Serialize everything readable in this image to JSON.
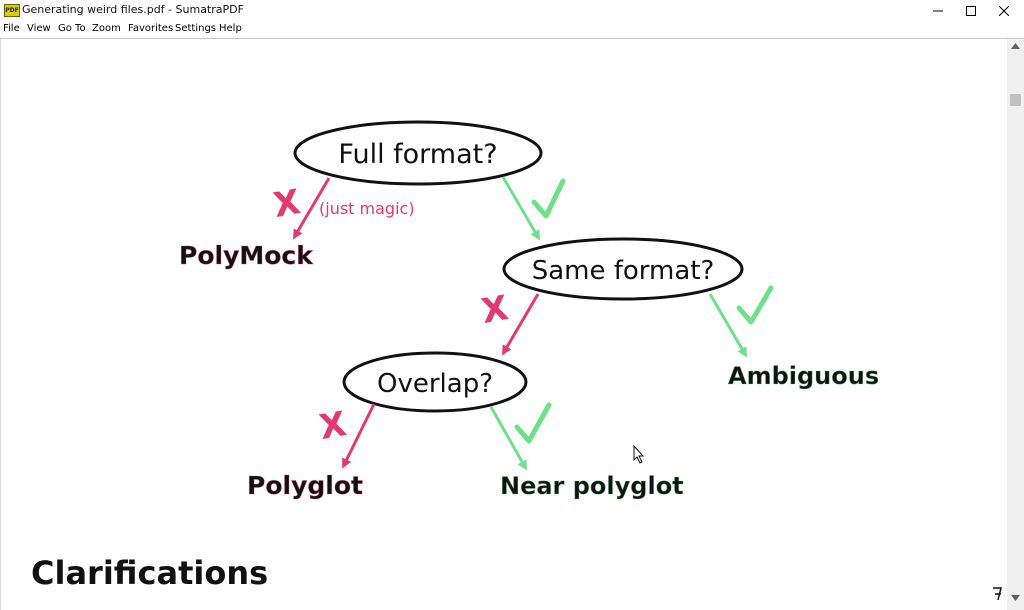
{
  "window": {
    "icon_label": "PDF",
    "title": "Generating weird files.pdf - SumatraPDF"
  },
  "menu": {
    "file": "File",
    "view": "View",
    "goto": "Go To",
    "zoom": "Zoom",
    "favorites": "Favorites",
    "settings": "Settings",
    "help": "Help"
  },
  "diagram": {
    "q_full_format": "Full format?",
    "q_same_format": "Same format?",
    "q_overlap": "Overlap?",
    "note_just_magic": "(just magic)",
    "out_polymock": "PolyMock",
    "out_ambiguous": "Ambiguous",
    "out_polyglot": "Polyglot",
    "out_near_polyglot": "Near polyglot",
    "no_mark": "X",
    "colors": {
      "no": "#e23a6e",
      "yes": "#6ee08a",
      "ink": "#111111"
    }
  },
  "page": {
    "heading": "Clarifications"
  }
}
